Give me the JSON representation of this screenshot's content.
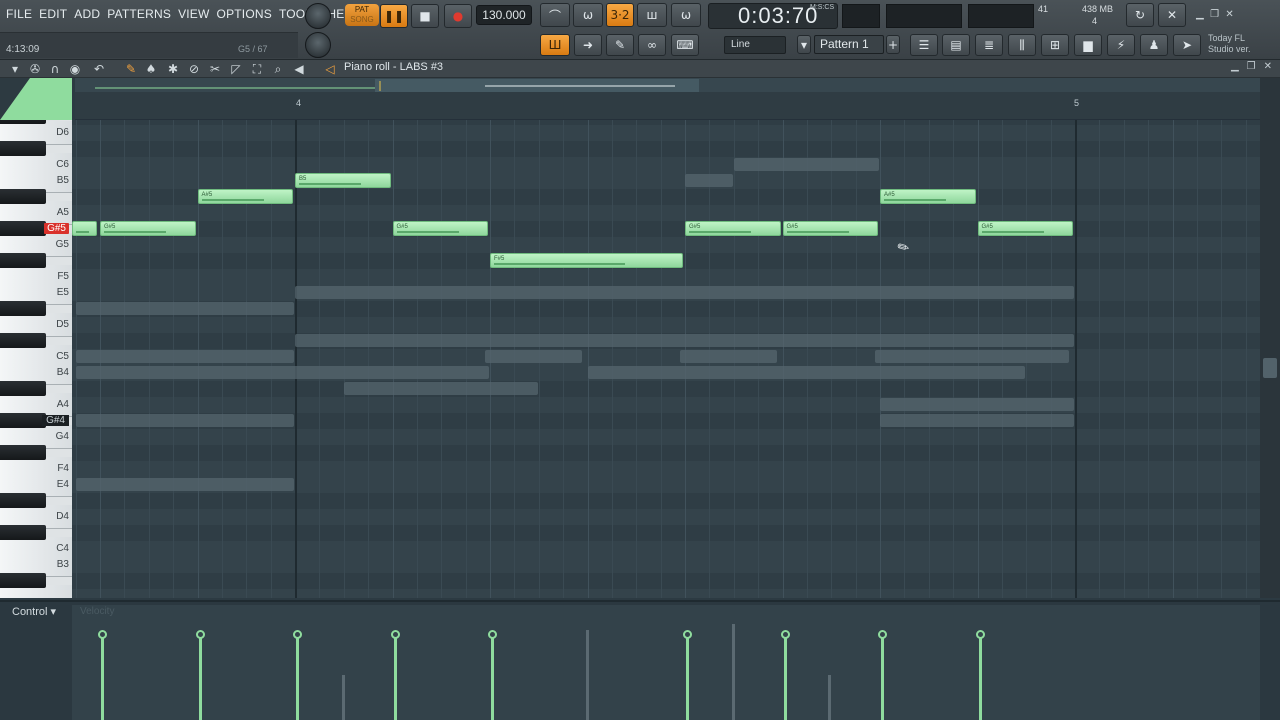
{
  "menu": [
    "FILE",
    "EDIT",
    "ADD",
    "PATTERNS",
    "VIEW",
    "OPTIONS",
    "TOOLS",
    "HELP"
  ],
  "hint": {
    "position": "4:13:09",
    "key_info": "G5 / 67"
  },
  "transport": {
    "pat_label": "PAT",
    "song_label": "SONG",
    "pause_icon": "pause-icon",
    "stop_icon": "stop-icon",
    "record_icon": "record-icon",
    "tempo": "130.000",
    "time": "0:03:70",
    "time_unit": "M:S:CS"
  },
  "meters": {
    "cpu": "41",
    "memory": "438 MB",
    "polyphony": "4"
  },
  "snap": "Line",
  "pattern": "Pattern 1",
  "news": {
    "line1": "Today  FL",
    "line2": "Studio ver."
  },
  "piano_roll": {
    "title": "Piano roll - LABS #3",
    "ruler": [
      "4",
      "5"
    ],
    "keys": [
      "D6",
      "C6",
      "B5",
      "A5",
      "G#5",
      "G5",
      "F5",
      "E5",
      "D5",
      "C5",
      "B4",
      "A4",
      "G#4",
      "G4",
      "F4",
      "E4",
      "D4",
      "C4",
      "B3"
    ],
    "notes": [
      {
        "label": "G#5",
        "pitch": "G#5",
        "start": 0.25,
        "len": 1.0
      },
      {
        "label": "A#5",
        "pitch": "A#5",
        "start": 1.25,
        "len": 1.0
      },
      {
        "label": "B5",
        "pitch": "B5",
        "start": 2.25,
        "len": 1.0
      },
      {
        "label": "G#5",
        "pitch": "G#5",
        "start": 3.25,
        "len": 1.0
      },
      {
        "label": "F#5",
        "pitch": "F#5",
        "start": 4.25,
        "len": 2.0
      },
      {
        "label": "G#5",
        "pitch": "G#5",
        "start": 6.25,
        "len": 1.0
      },
      {
        "label": "G#5",
        "pitch": "G#5",
        "start": 7.25,
        "len": 1.0
      },
      {
        "label": "A#5",
        "pitch": "A#5",
        "start": 8.25,
        "len": 1.0
      },
      {
        "label": "G#5",
        "pitch": "G#5",
        "start": 9.25,
        "len": 1.0
      }
    ]
  },
  "event_panel": {
    "control_label": "Control",
    "velocity_label": "Velocity"
  },
  "colors": {
    "accent": "#f2a23e",
    "note": "#9fe3ab",
    "key_highlight": "#d9312b",
    "grid": "#34434b"
  }
}
